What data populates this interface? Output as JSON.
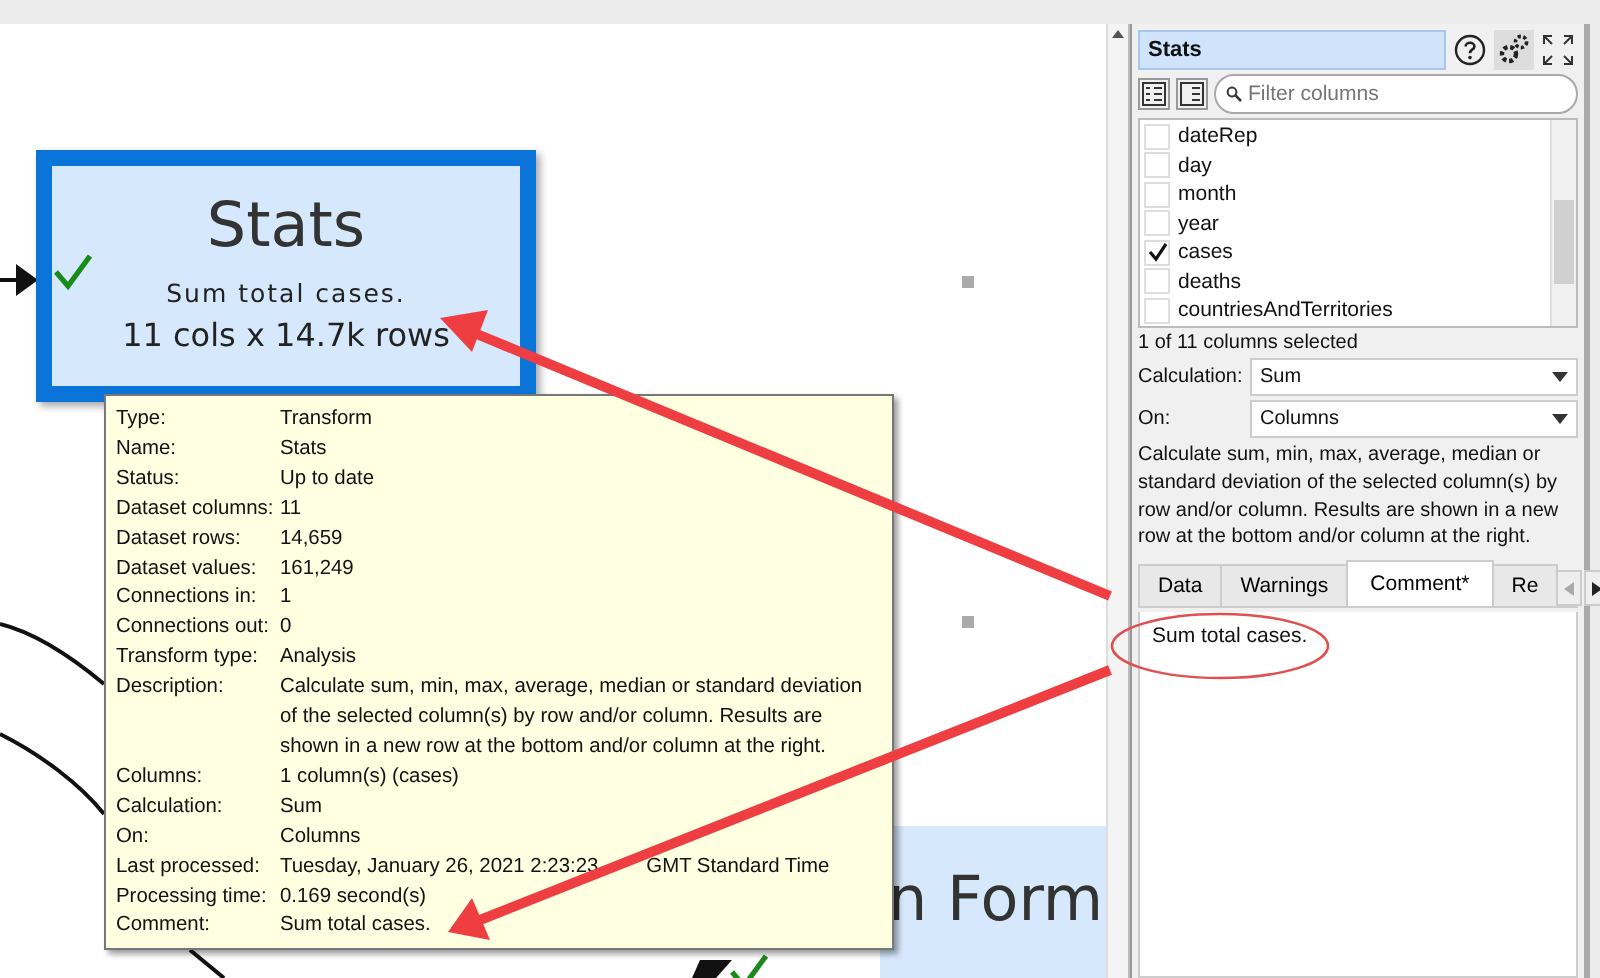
{
  "canvas": {
    "nodes": [
      {
        "title": "Stats",
        "comment": "Sum total cases.",
        "size": "11 cols x 14.7k rows",
        "selected": true
      },
      {
        "title": "n Form",
        "selected": false
      }
    ]
  },
  "tooltip": {
    "rows": [
      {
        "label": "Type:",
        "value": "Transform"
      },
      {
        "label": "Name:",
        "value": "Stats"
      },
      {
        "label": "Status:",
        "value": "Up to date"
      },
      {
        "label": "Dataset columns:",
        "value": "11"
      },
      {
        "label": "Dataset rows:",
        "value": "14,659"
      },
      {
        "label": "Dataset values:",
        "value": "161,249"
      },
      {
        "label": "Connections in:",
        "value": "1"
      },
      {
        "label": "Connections out:",
        "value": "0"
      },
      {
        "label": "Transform type:",
        "value": "Analysis"
      },
      {
        "label": "Description:",
        "value": "Calculate sum, min, max, average, median or standard deviation of the selected column(s) by row and/or column. Results are shown in a new row at the bottom and/or column at the right."
      },
      {
        "label": "Columns:",
        "value": "1 column(s) (cases)"
      },
      {
        "label": "Calculation:",
        "value": "Sum"
      },
      {
        "label": "On:",
        "value": "Columns"
      },
      {
        "label": "Last processed:",
        "value": "Tuesday, January 26, 2021 2:23:23",
        "value_after_arrow": "GMT Standard Time"
      },
      {
        "label": "Processing time:",
        "value": "0.169 second(s)"
      },
      {
        "label": "Comment:",
        "value": "Sum total cases."
      }
    ]
  },
  "panel": {
    "title": "Stats",
    "filter": {
      "placeholder": "Filter columns"
    },
    "columns": [
      {
        "label": "dateRep",
        "checked": false
      },
      {
        "label": "day",
        "checked": false
      },
      {
        "label": "month",
        "checked": false
      },
      {
        "label": "year",
        "checked": false
      },
      {
        "label": "cases",
        "checked": true
      },
      {
        "label": "deaths",
        "checked": false
      },
      {
        "label": "countriesAndTerritories",
        "checked": false
      }
    ],
    "selection_status": "1 of 11 columns selected",
    "fields": [
      {
        "label": "Calculation:",
        "value": "Sum"
      },
      {
        "label": "On:",
        "value": "Columns"
      }
    ],
    "description": "Calculate sum, min, max, average, median or standard deviation of the selected column(s) by row and/or column. Results are shown in a new row at the bottom and/or column at the right.",
    "tabs": [
      {
        "label": "Data",
        "selected": false
      },
      {
        "label": "Warnings",
        "selected": false
      },
      {
        "label": "Comment*",
        "selected": true
      },
      {
        "label": "Re",
        "selected": false
      }
    ],
    "comment": "Sum total cases."
  }
}
